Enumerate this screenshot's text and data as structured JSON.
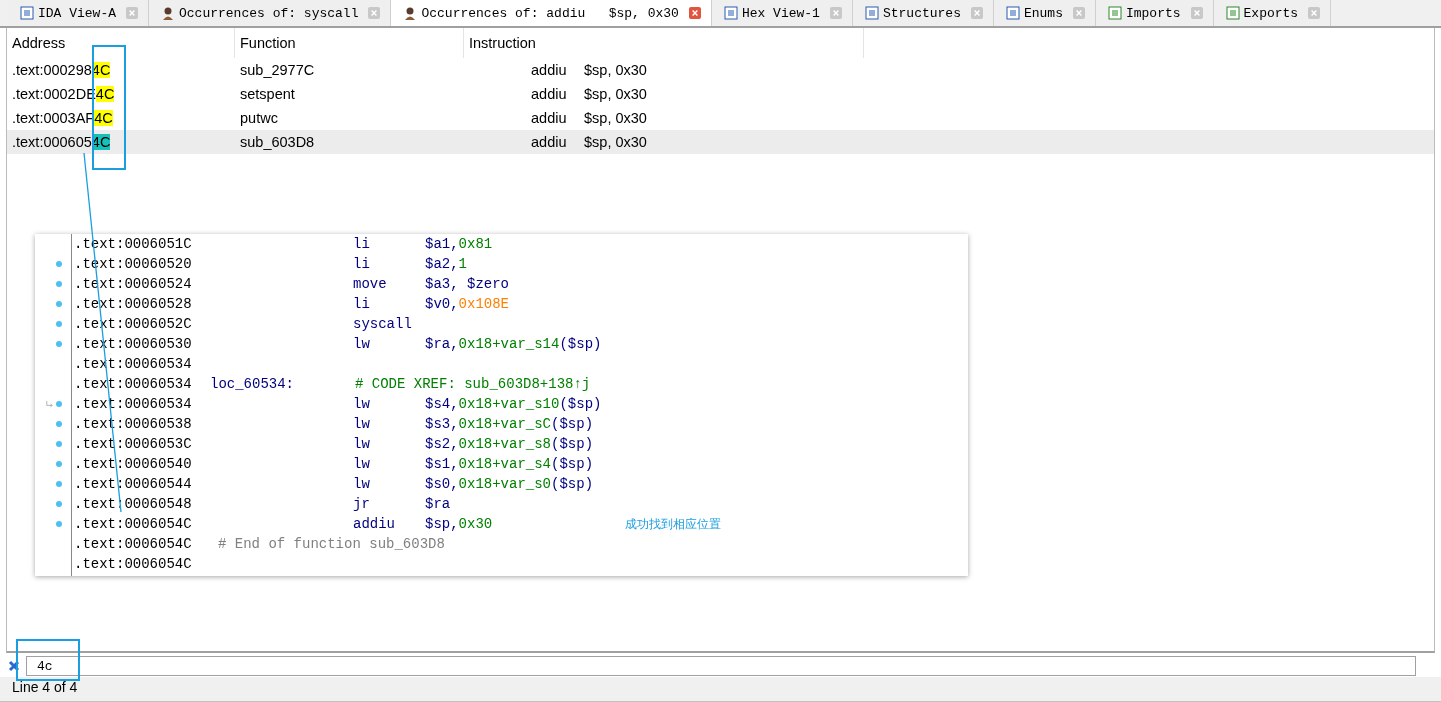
{
  "tabs": [
    {
      "label": "IDA View-A",
      "selected": false
    },
    {
      "label": "Occurrences of: syscall",
      "selected": false
    },
    {
      "label": "Occurrences of: addiu   $sp, 0x30",
      "selected": true
    },
    {
      "label": "Hex View-1",
      "selected": false
    },
    {
      "label": "Structures",
      "selected": false
    },
    {
      "label": "Enums",
      "selected": false
    },
    {
      "label": "Imports",
      "selected": false
    },
    {
      "label": "Exports",
      "selected": false
    }
  ],
  "table": {
    "columns": [
      "Address",
      "Function",
      "Instruction"
    ],
    "rows": [
      {
        "address": ".text:000298",
        "match": "4C",
        "function": "sub_2977C",
        "mnemonic": "addiu",
        "operands": "$sp, 0x30",
        "selected": false
      },
      {
        "address": ".text:0002DE",
        "match": "4C",
        "function": "setspent",
        "mnemonic": "addiu",
        "operands": "$sp, 0x30",
        "selected": false
      },
      {
        "address": ".text:0003AF",
        "match": "4C",
        "function": "putwc",
        "mnemonic": "addiu",
        "operands": "$sp, 0x30",
        "selected": false
      },
      {
        "address": ".text:000605",
        "match": "4C",
        "function": "sub_603D8",
        "mnemonic": "addiu",
        "operands": "$sp, 0x30",
        "selected": true
      }
    ]
  },
  "listing": {
    "lines": [
      {
        "address": ".text:0006051C",
        "mnemonic": "li",
        "reg": "$a1,",
        "value": "0x81",
        "kind": "number",
        "marked": false,
        "xref_arrow": false
      },
      {
        "address": ".text:00060520",
        "mnemonic": "li",
        "reg": "$a2,",
        "value": "1",
        "kind": "number",
        "marked": true,
        "xref_arrow": false
      },
      {
        "address": ".text:00060524",
        "mnemonic": "move",
        "reg": "$a3, $zero",
        "marked": true,
        "xref_arrow": false
      },
      {
        "address": ".text:00060528",
        "mnemonic": "li",
        "reg": "$v0,",
        "value": "0x108E",
        "kind": "constant",
        "marked": true,
        "xref_arrow": false
      },
      {
        "address": ".text:0006052C",
        "mnemonic": "syscall",
        "marked": true,
        "xref_arrow": false
      },
      {
        "address": ".text:00060530",
        "mnemonic": "lw",
        "reg": "$ra,",
        "value": "0x18+var_s14",
        "suffix": "($sp)",
        "kind": "number",
        "marked": true,
        "xref_arrow": false
      },
      {
        "address": ".text:00060534",
        "marked": false,
        "xref_arrow": false
      },
      {
        "address": ".text:00060534",
        "label": "loc_60534:",
        "comment": "# CODE XREF: sub_603D8+138↑j",
        "marked": false,
        "xref_arrow": false
      },
      {
        "address": ".text:00060534",
        "mnemonic": "lw",
        "reg": "$s4,",
        "value": "0x18+var_s10",
        "suffix": "($sp)",
        "kind": "number",
        "marked": true,
        "xref_arrow": true
      },
      {
        "address": ".text:00060538",
        "mnemonic": "lw",
        "reg": "$s3,",
        "value": "0x18+var_sC",
        "suffix": "($sp)",
        "kind": "number",
        "marked": true,
        "xref_arrow": false
      },
      {
        "address": ".text:0006053C",
        "mnemonic": "lw",
        "reg": "$s2,",
        "value": "0x18+var_s8",
        "suffix": "($sp)",
        "kind": "number",
        "marked": true,
        "xref_arrow": false
      },
      {
        "address": ".text:00060540",
        "mnemonic": "lw",
        "reg": "$s1,",
        "value": "0x18+var_s4",
        "suffix": "($sp)",
        "kind": "number",
        "marked": true,
        "xref_arrow": false
      },
      {
        "address": ".text:00060544",
        "mnemonic": "lw",
        "reg": "$s0,",
        "value": "0x18+var_s0",
        "suffix": "($sp)",
        "kind": "number",
        "marked": true,
        "xref_arrow": false
      },
      {
        "address": ".text:00060548",
        "mnemonic": "jr",
        "reg": "$ra",
        "marked": true,
        "xref_arrow": false
      },
      {
        "address": ".text:0006054C",
        "mnemonic": "addiu",
        "reg": "$sp,",
        "value": "0x30",
        "kind": "number",
        "marked": true,
        "xref_arrow": false,
        "note": "成功找到相应位置"
      },
      {
        "address": ".text:0006054C",
        "end_comment": "# End of function sub_603D8",
        "marked": false,
        "xref_arrow": false
      },
      {
        "address": ".text:0006054C",
        "marked": false,
        "xref_arrow": false
      }
    ]
  },
  "search": {
    "value": "4c"
  },
  "status_bar": "Line 4 of 4"
}
